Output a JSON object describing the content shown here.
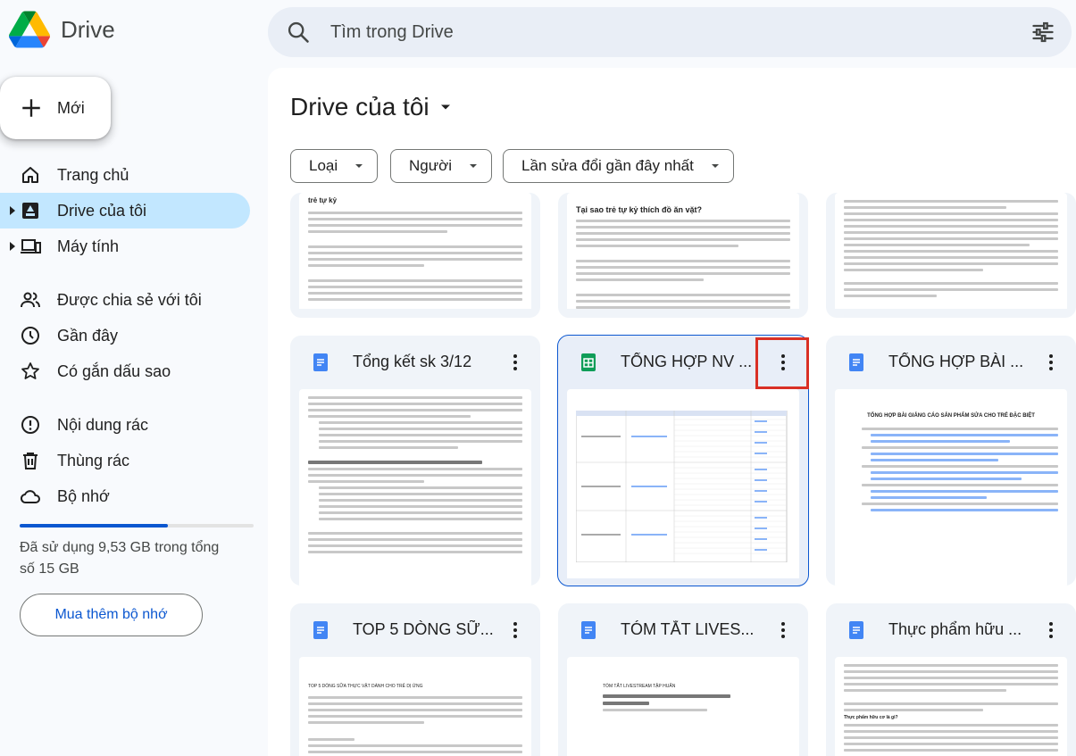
{
  "app": {
    "name": "Drive"
  },
  "search": {
    "placeholder": "Tìm trong Drive"
  },
  "new_button": {
    "label": "Mới"
  },
  "sidebar": {
    "items": [
      {
        "label": "Trang chủ",
        "icon": "home-icon"
      },
      {
        "label": "Drive của tôi",
        "icon": "my-drive-icon",
        "active": true
      },
      {
        "label": "Máy tính",
        "icon": "computer-icon"
      },
      {
        "label": "Được chia sẻ với tôi",
        "icon": "shared-icon"
      },
      {
        "label": "Gần đây",
        "icon": "clock-icon"
      },
      {
        "label": "Có gắn dấu sao",
        "icon": "star-icon"
      },
      {
        "label": "Nội dung rác",
        "icon": "spam-icon"
      },
      {
        "label": "Thùng rác",
        "icon": "trash-icon"
      },
      {
        "label": "Bộ nhớ",
        "icon": "cloud-icon"
      }
    ]
  },
  "storage": {
    "used_fraction": 0.635,
    "text": "Đã sử dụng 9,53 GB trong tổng số 15 GB",
    "buy_label": "Mua thêm bộ nhớ"
  },
  "main": {
    "title": "Drive của tôi",
    "filters": [
      {
        "label": "Loại"
      },
      {
        "label": "Người"
      },
      {
        "label": "Lần sửa đổi gần đây nhất"
      }
    ],
    "top_row_text": {
      "card1_heading": "trẻ tự kỷ",
      "card2_heading": "Tại sao trẻ tự kỷ thích đồ ăn vặt?"
    },
    "files": [
      {
        "title": "Tổng kết sk 3/12",
        "type": "docs"
      },
      {
        "title": "TỔNG HỢP NV ...",
        "type": "sheets",
        "selected": true
      },
      {
        "title": "TỔNG HỢP BÀI ...",
        "type": "docs"
      },
      {
        "title": "TOP 5 DÒNG SỮ...",
        "type": "docs"
      },
      {
        "title": "TÓM TẮT LIVES...",
        "type": "docs"
      },
      {
        "title": "Thực phẩm hữu ...",
        "type": "docs"
      }
    ],
    "thumb_text": {
      "bai_title": "TỔNG HỢP BÀI GIẢNG CÁO SẢN PHẨM SỬA CHO TRẺ ĐẶC BIỆT",
      "top5_title": "TOP 5 DÒNG SỮA THỰC VẬT DÀNH CHO TRẺ DỊ ỨNG",
      "tomtat_title": "TÓM TẮT LIVESTREAM TẬP HUẤN",
      "thucpham_q": "Thực phẩm hữu cơ là gì?"
    }
  },
  "colors": {
    "accent": "#0b57d0",
    "active_bg": "#c2e7ff",
    "docs_blue": "#4285f4",
    "sheets_green": "#0f9d58",
    "highlight_red": "#d93025"
  }
}
